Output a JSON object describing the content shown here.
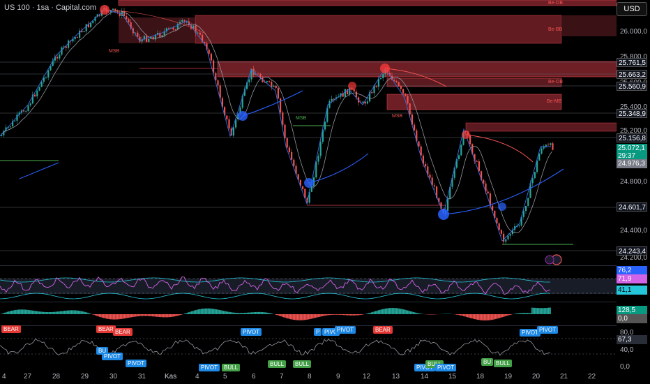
{
  "header": {
    "title": "US 100 · 1sa · Capital.com",
    "currency": "USD"
  },
  "price_axis": {
    "labels": [
      "26.000,0",
      "25.800,0",
      "25.600,0",
      "25.400,0",
      "25.200,0",
      "24.800,0",
      "24.400,0",
      "24.200,0"
    ],
    "badges": {
      "b1": "25.761,5",
      "b2": "25.663,2",
      "b3": "25.560,9",
      "b4": "25.348,9",
      "b5": "25.156,8",
      "current": "25.072,1",
      "countdown": "29:37",
      "b6": "24.976,3",
      "b7": "24.601,7",
      "b8": "24.243,4"
    }
  },
  "zone_labels": {
    "z1": "Be-OB",
    "z2": "Be-BB",
    "z3": "Be-OB",
    "z4": "Be-MB"
  },
  "annotations": {
    "msb1": "MSB",
    "msb2": "MSB",
    "msb3": "MSB"
  },
  "rsi_pane": {
    "v1": "76,2",
    "v2": "71,9",
    "v3": "41,1"
  },
  "momentum_pane": {
    "v1": "128,5",
    "v2": "0,0"
  },
  "signal_pane": {
    "scale": [
      "80,0",
      "40,0",
      "0,0"
    ],
    "value": "67,3",
    "s": {
      "bear1": "BEAR",
      "bear2": "BEAR",
      "bear3": "BEAR",
      "bu1": "BU",
      "pivot1": "PIVOT",
      "pivot2": "PIVOT",
      "pivot3": "PIVOT",
      "pivot4": "PIVOT",
      "bull1": "BULL",
      "bull2": "BULL",
      "bull3": "BULL",
      "pivot5": "PIVOT",
      "p6": "P",
      "pivc": "PIVC",
      "pivot7": "PIVOT",
      "bear4": "BEAR",
      "pivot8": "PIVOT",
      "bull4": "BULL",
      "pivot9": "PIVOT",
      "pivot10": "PIVOT",
      "bu2": "BU",
      "bull5": "BULL",
      "pivot11": "PIVOT",
      "pivot12": "PIVOT",
      "pivot13": "PIVOT"
    }
  },
  "x_axis": [
    "4",
    "27",
    "28",
    "29",
    "30",
    "31",
    "Kas",
    "4",
    "5",
    "6",
    "7",
    "8",
    "9",
    "12",
    "13",
    "14",
    "15",
    "18",
    "19",
    "20",
    "21",
    "22"
  ],
  "colors": {
    "up": "#26a69a",
    "down": "#ef5350",
    "zone": "#b2313a",
    "blue": "#2962ff",
    "rsi": "#d163e8"
  }
}
